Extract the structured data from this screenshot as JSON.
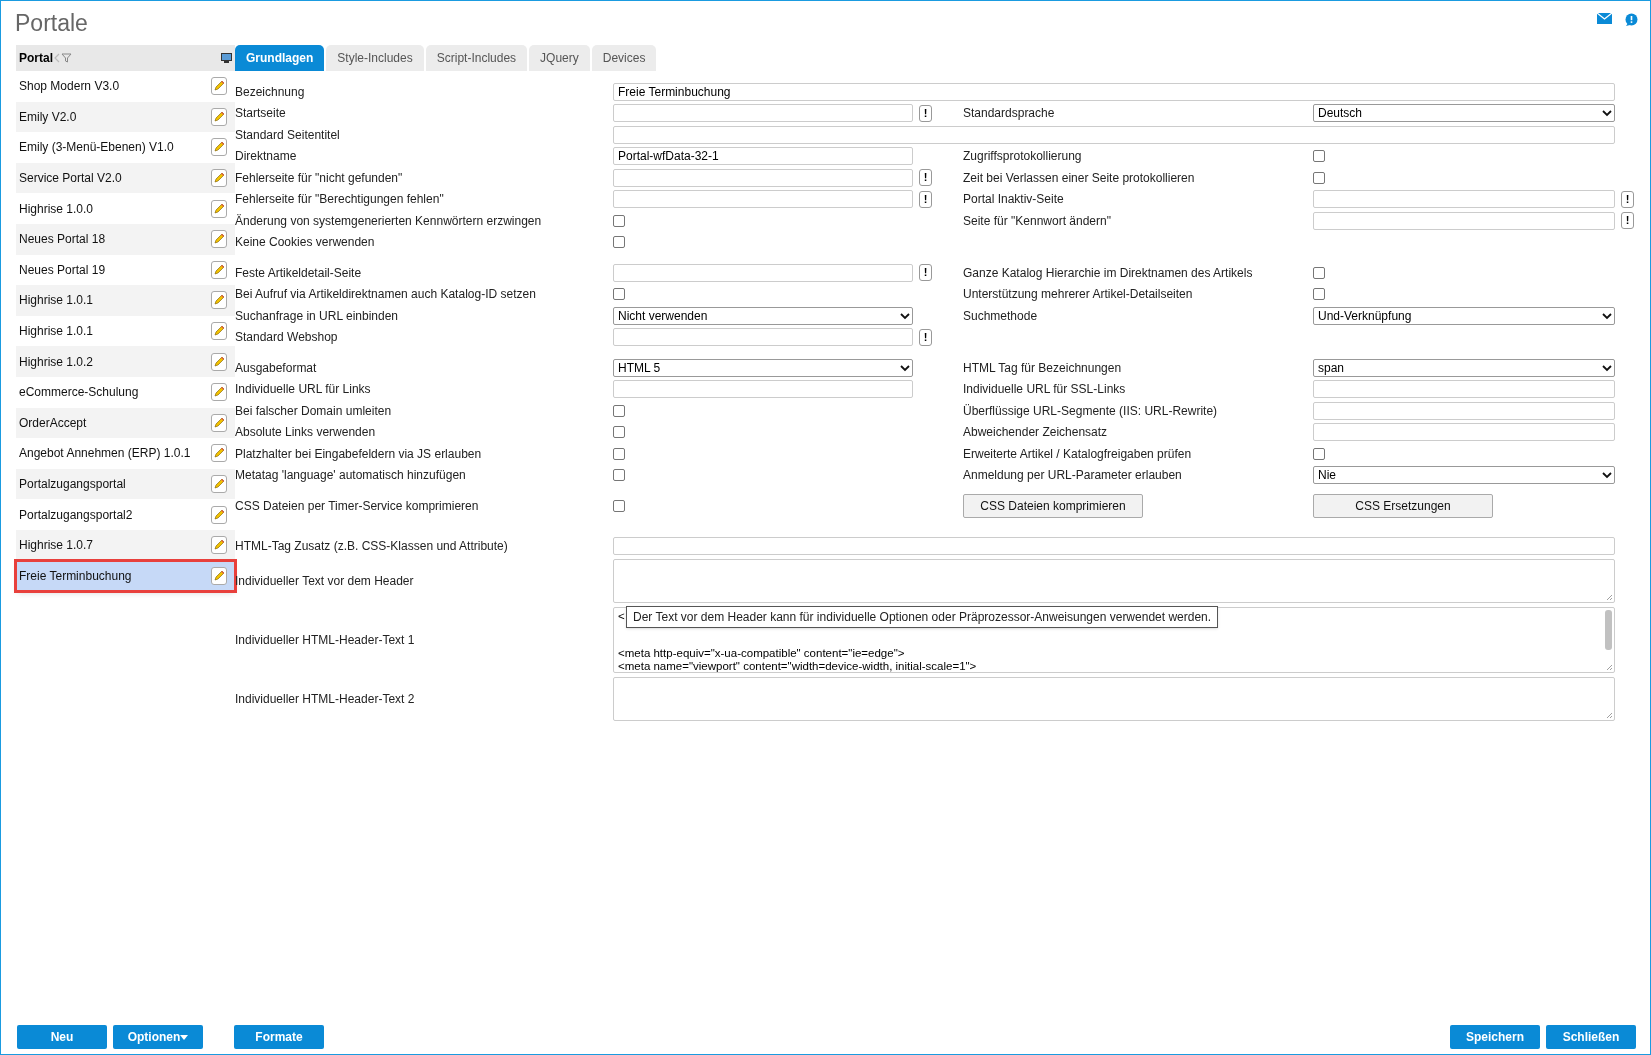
{
  "title": "Portale",
  "sidebar": {
    "header": "Portal",
    "items": [
      {
        "label": "Shop Modern V3.0",
        "selected": false
      },
      {
        "label": "Emily V2.0",
        "selected": false
      },
      {
        "label": "Emily (3-Menü-Ebenen) V1.0",
        "selected": false
      },
      {
        "label": "Service Portal V2.0",
        "selected": false
      },
      {
        "label": "Highrise 1.0.0",
        "selected": false
      },
      {
        "label": "Neues Portal 18",
        "selected": false
      },
      {
        "label": "Neues Portal 19",
        "selected": false
      },
      {
        "label": "Highrise 1.0.1",
        "selected": false
      },
      {
        "label": "Highrise 1.0.1",
        "selected": false
      },
      {
        "label": "Highrise 1.0.2",
        "selected": false
      },
      {
        "label": "eCommerce-Schulung",
        "selected": false
      },
      {
        "label": "OrderAccept",
        "selected": false
      },
      {
        "label": "Angebot Annehmen (ERP) 1.0.1",
        "selected": false
      },
      {
        "label": "Portalzugangsportal",
        "selected": false
      },
      {
        "label": "Portalzugangsportal2",
        "selected": false
      },
      {
        "label": "Highrise 1.0.7",
        "selected": false
      },
      {
        "label": "Freie Terminbuchung",
        "selected": true
      }
    ]
  },
  "tabs": [
    {
      "label": "Grundlagen",
      "selected": true
    },
    {
      "label": "Style-Includes",
      "selected": false
    },
    {
      "label": "Script-Includes",
      "selected": false
    },
    {
      "label": "JQuery",
      "selected": false
    },
    {
      "label": "Devices",
      "selected": false
    }
  ],
  "sections": [
    {
      "rows": [
        {
          "left": {
            "label": "Bezeichnung",
            "kind": "wide",
            "value": "Freie Terminbuchung"
          }
        },
        {
          "left": {
            "label": "Startseite",
            "kind": "text",
            "hint": "!"
          },
          "right": {
            "label": "Standardsprache",
            "kind": "select",
            "value": "Deutsch"
          }
        },
        {
          "left": {
            "label": "Standard Seitentitel",
            "kind": "wide"
          }
        },
        {
          "left": {
            "label": "Direktname",
            "kind": "text",
            "value": "Portal-wfData-32-1"
          },
          "right": {
            "label": "Zugriffsprotokollierung",
            "kind": "checkbox",
            "checked": false
          }
        },
        {
          "left": {
            "label": "Fehlerseite für \"nicht gefunden\"",
            "kind": "text",
            "hint": "!"
          },
          "right": {
            "label": "Zeit bei Verlassen einer Seite protokollieren",
            "kind": "checkbox",
            "checked": false
          }
        },
        {
          "left": {
            "label": "Fehlerseite für \"Berechtigungen fehlen\"",
            "kind": "text",
            "hint": "!"
          },
          "right": {
            "label": "Portal Inaktiv-Seite",
            "kind": "text",
            "hint": "!"
          }
        },
        {
          "left": {
            "label": "Änderung von systemgenerierten Kennwörtern erzwingen",
            "kind": "checkbox",
            "checked": false
          },
          "right": {
            "label": "Seite für \"Kennwort ändern\"",
            "kind": "text",
            "hint": "!"
          }
        },
        {
          "left": {
            "label": "Keine Cookies verwenden",
            "kind": "checkbox",
            "checked": false
          }
        }
      ]
    },
    {
      "rows": [
        {
          "left": {
            "label": "Feste Artikeldetail-Seite",
            "kind": "text",
            "hint": "!"
          },
          "right": {
            "label": "Ganze Katalog Hierarchie im Direktnamen des Artikels",
            "kind": "checkbox",
            "checked": false
          }
        },
        {
          "left": {
            "label": "Bei Aufruf via Artikeldirektnamen auch Katalog-ID setzen",
            "kind": "checkbox",
            "checked": false
          },
          "right": {
            "label": "Unterstützung mehrerer Artikel-Detailseiten",
            "kind": "checkbox",
            "checked": false
          }
        },
        {
          "left": {
            "label": "Suchanfrage in URL einbinden",
            "kind": "select",
            "value": "Nicht verwenden"
          },
          "right": {
            "label": "Suchmethode",
            "kind": "select",
            "value": "Und-Verknüpfung"
          }
        },
        {
          "left": {
            "label": "Standard Webshop",
            "kind": "text",
            "hint": "!"
          }
        }
      ]
    },
    {
      "rows": [
        {
          "left": {
            "label": "Ausgabeformat",
            "kind": "select",
            "value": "HTML 5"
          },
          "right": {
            "label": "HTML Tag für Bezeichnungen",
            "kind": "select",
            "value": "span"
          }
        },
        {
          "left": {
            "label": "Individuelle URL für Links",
            "kind": "text"
          },
          "right": {
            "label": "Individuelle URL für SSL-Links",
            "kind": "text"
          }
        },
        {
          "left": {
            "label": "Bei falscher Domain umleiten",
            "kind": "checkbox",
            "checked": false
          },
          "right": {
            "label": "Überflüssige URL-Segmente (IIS: URL-Rewrite)",
            "kind": "text"
          }
        },
        {
          "left": {
            "label": "Absolute Links verwenden",
            "kind": "checkbox",
            "checked": false
          },
          "right": {
            "label": "Abweichender Zeichensatz",
            "kind": "text"
          }
        },
        {
          "left": {
            "label": "Platzhalter bei Eingabefeldern via JS erlauben",
            "kind": "checkbox",
            "checked": false
          },
          "right": {
            "label": "Erweiterte Artikel / Katalogfreigaben prüfen",
            "kind": "checkbox",
            "checked": false
          }
        },
        {
          "left": {
            "label": "Metatag 'language' automatisch hinzufügen",
            "kind": "checkbox",
            "checked": false
          },
          "right": {
            "label": "Anmeldung per URL-Parameter erlauben",
            "kind": "select",
            "value": "Nie"
          }
        }
      ]
    },
    {
      "rows": [
        {
          "left": {
            "label": "CSS Dateien per Timer-Service komprimieren",
            "kind": "checkbox",
            "checked": false
          },
          "right": {
            "kind": "buttons",
            "buttons": [
              "CSS Dateien komprimieren",
              "CSS Ersetzungen"
            ]
          }
        }
      ]
    },
    {
      "rows": [
        {
          "left": {
            "label": "HTML-Tag Zusatz (z.B. CSS-Klassen und Attribute)",
            "kind": "wide"
          }
        },
        {
          "left": {
            "label": "Individueller Text vor dem Header",
            "kind": "textarea"
          }
        },
        {
          "left": {
            "label": "Individueller HTML-Header-Text 1",
            "kind": "textarea",
            "lines": [
              "<",
              "<meta http-equiv=\"x-ua-compatible\" content=\"ie=edge\">",
              "<meta name=\"viewport\" content=\"width=device-width, initial-scale=1\">"
            ],
            "tooltip": "Der Text vor dem Header kann für individuelle Optionen oder Präprozessor-Anweisungen verwendet werden."
          }
        },
        {
          "left": {
            "label": "Individueller HTML-Header-Text 2",
            "kind": "textarea"
          }
        }
      ]
    }
  ],
  "footer": {
    "left": [
      "Neu",
      "Optionen"
    ],
    "middle": [
      "Formate"
    ],
    "right": [
      "Speichern",
      "Schließen"
    ]
  }
}
